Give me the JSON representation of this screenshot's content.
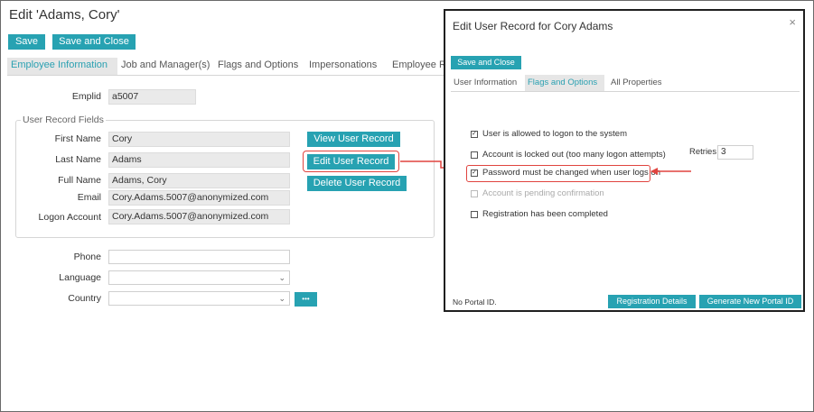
{
  "page": {
    "title": "Edit 'Adams, Cory'",
    "save_label": "Save",
    "save_close_label": "Save and Close"
  },
  "tabs": [
    {
      "label": "Employee Information"
    },
    {
      "label": "Job and Manager(s)"
    },
    {
      "label": "Flags and Options"
    },
    {
      "label": "Impersonations"
    },
    {
      "label": "Employee R"
    }
  ],
  "form": {
    "emplid_label": "Emplid",
    "emplid_value": "a5007",
    "fieldset_legend": "User Record Fields",
    "first_name_label": "First Name",
    "first_name_value": "Cory",
    "last_name_label": "Last Name",
    "last_name_value": "Adams",
    "full_name_label": "Full Name",
    "full_name_value": "Adams, Cory",
    "email_label": "Email",
    "email_value": "Cory.Adams.5007@anonymized.com",
    "logon_label": "Logon Account",
    "logon_value": "Cory.Adams.5007@anonymized.com",
    "view_btn": "View User Record",
    "edit_btn": "Edit User Record",
    "delete_btn": "Delete User Record",
    "phone_label": "Phone",
    "language_label": "Language",
    "country_label": "Country",
    "more_btn": "•••"
  },
  "dialog": {
    "title": "Edit User Record for Cory Adams",
    "close": "×",
    "save_close_label": "Save and Close",
    "tabs": [
      {
        "label": "User Information"
      },
      {
        "label": "Flags and Options"
      },
      {
        "label": "All Properties"
      }
    ],
    "options": [
      {
        "label": "User is allowed to logon to the system",
        "checked": true,
        "disabled": false
      },
      {
        "label": "Account is locked out (too many logon attempts)",
        "checked": false,
        "disabled": false
      },
      {
        "label": "Password must be changed when user logs on",
        "checked": true,
        "disabled": false
      },
      {
        "label": "Account is pending confirmation",
        "checked": false,
        "disabled": true
      },
      {
        "label": "Registration has been completed",
        "checked": false,
        "disabled": false
      }
    ],
    "retries_label": "Retries",
    "retries_value": "3",
    "no_portal": "No Portal ID.",
    "registration_btn": "Registration Details",
    "generate_btn": "Generate New Portal ID"
  },
  "colors": {
    "accent": "#27a2b2",
    "highlight": "#e0443f"
  }
}
